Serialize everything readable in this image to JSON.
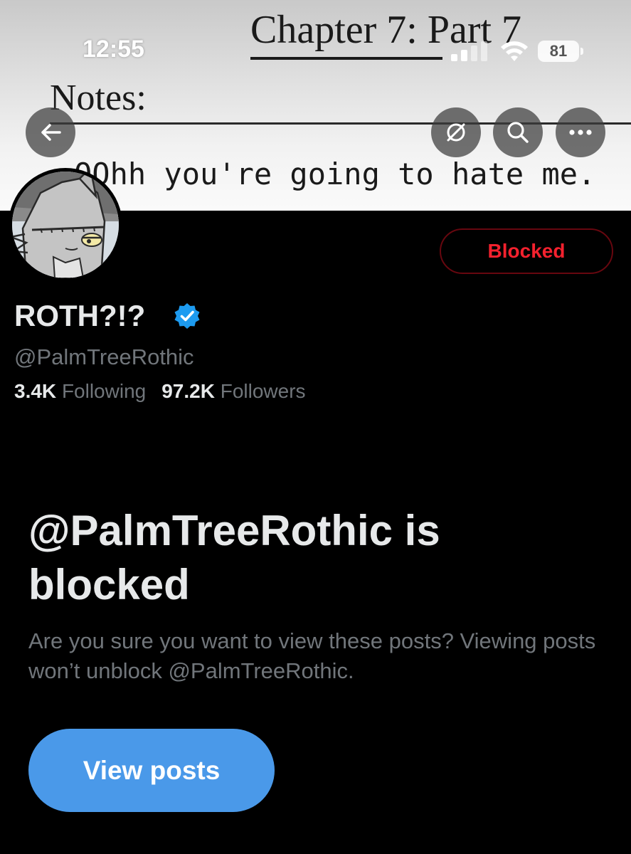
{
  "banner": {
    "chapter_text": "Chapter 7: Part 7",
    "notes_text": "Notes:",
    "quote_text": "OOhh you're going to hate me."
  },
  "status_bar": {
    "time": "12:55",
    "battery": "81"
  },
  "header": {
    "back_icon": "arrow-left-icon",
    "actions": [
      "crossed-out-circle-icon",
      "search-icon",
      "more-icon"
    ]
  },
  "profile": {
    "avatar_icon": "wolf-avatar",
    "blocked_button_label": "Blocked",
    "display_name": "ROTH?!?",
    "verified": true,
    "handle": "@PalmTreeRothic",
    "following_count": "3.4K",
    "following_label": "Following",
    "followers_count": "97.2K",
    "followers_label": "Followers"
  },
  "blocked_notice": {
    "title": "@PalmTreeRothic is blocked",
    "description": "Are you sure you want to view these posts? Viewing posts won’t unblock @PalmTreeRothic.",
    "view_posts_label": "View posts"
  },
  "colors": {
    "background": "#000000",
    "primary_text": "#e7e9ea",
    "secondary_text": "#71767b",
    "blocked_red": "#f4212e",
    "accent_blue": "#4a99e9",
    "verified_blue": "#1d9bf0"
  }
}
